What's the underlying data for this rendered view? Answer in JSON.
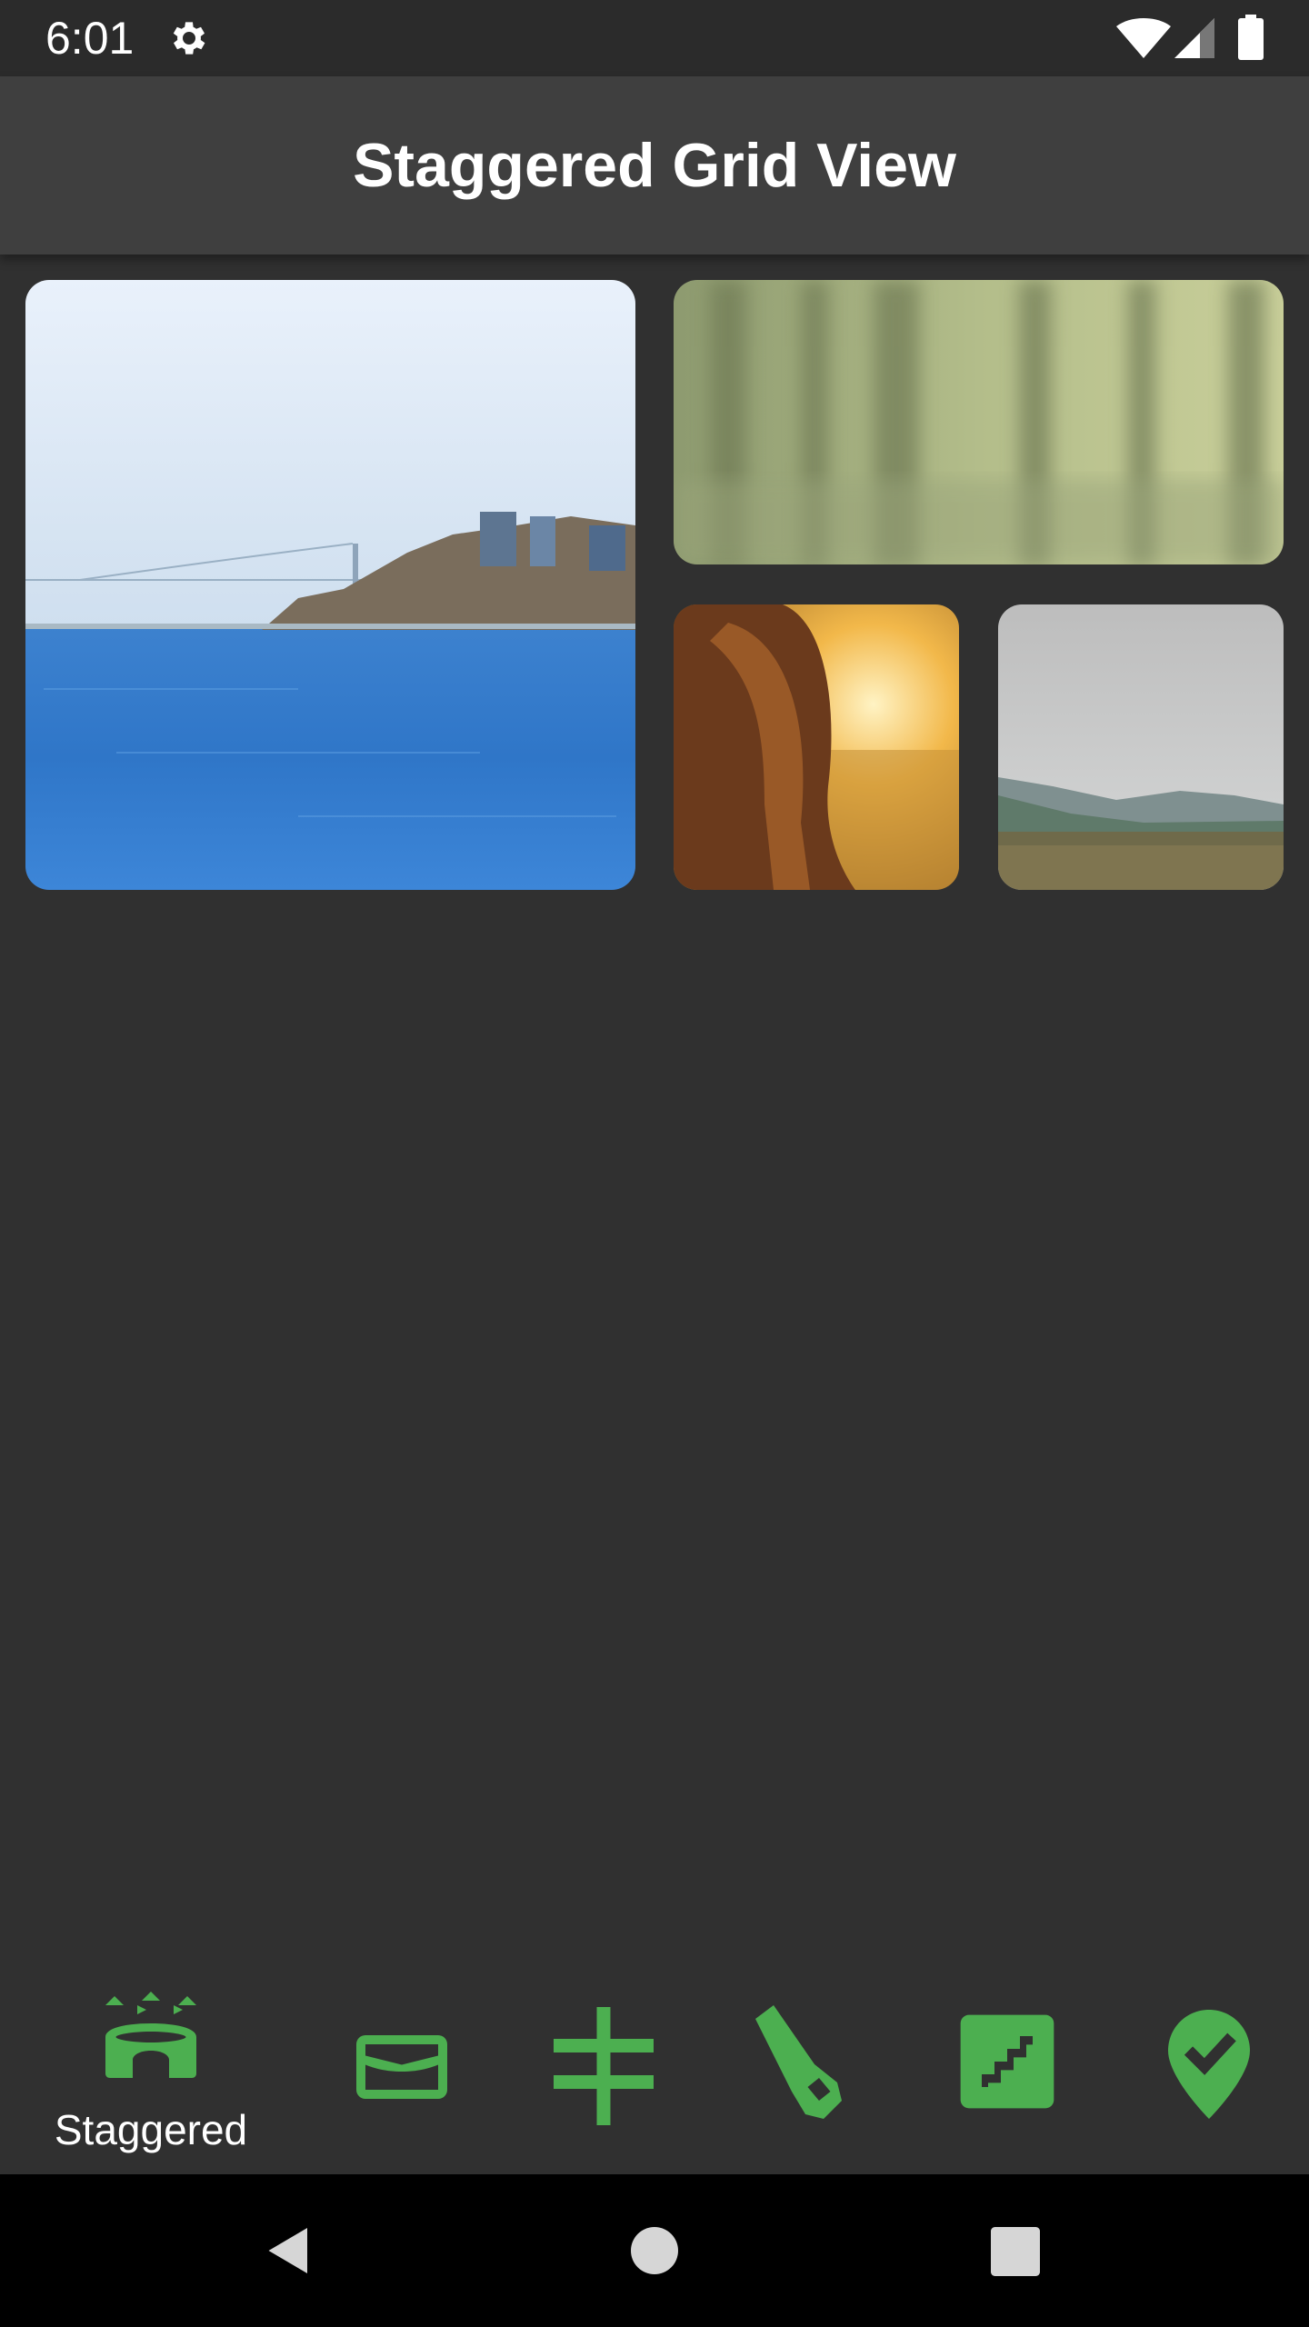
{
  "status_bar": {
    "time": "6:01",
    "icons": [
      "gear-icon",
      "wifi-icon",
      "signal-icon",
      "battery-icon"
    ]
  },
  "app_bar": {
    "title": "Staggered Grid View"
  },
  "grid": {
    "tiles": [
      {
        "subject": "city-bay-bridge-photo"
      },
      {
        "subject": "blurred-forest-photo"
      },
      {
        "subject": "girl-sunset-photo"
      },
      {
        "subject": "cloudy-valley-photo"
      }
    ]
  },
  "bottom_nav": {
    "accent_color": "#4caf50",
    "items": [
      {
        "icon": "stadium-icon",
        "label": "Staggered",
        "selected": true
      },
      {
        "icon": "wallet-icon",
        "label": ""
      },
      {
        "icon": "not-equal-cross-icon",
        "label": ""
      },
      {
        "icon": "flashlight-icon",
        "label": ""
      },
      {
        "icon": "stairs-icon",
        "label": ""
      },
      {
        "icon": "location-check-icon",
        "label": ""
      }
    ]
  },
  "system_nav": {
    "icons": [
      "back-icon",
      "home-icon",
      "recents-icon"
    ]
  }
}
